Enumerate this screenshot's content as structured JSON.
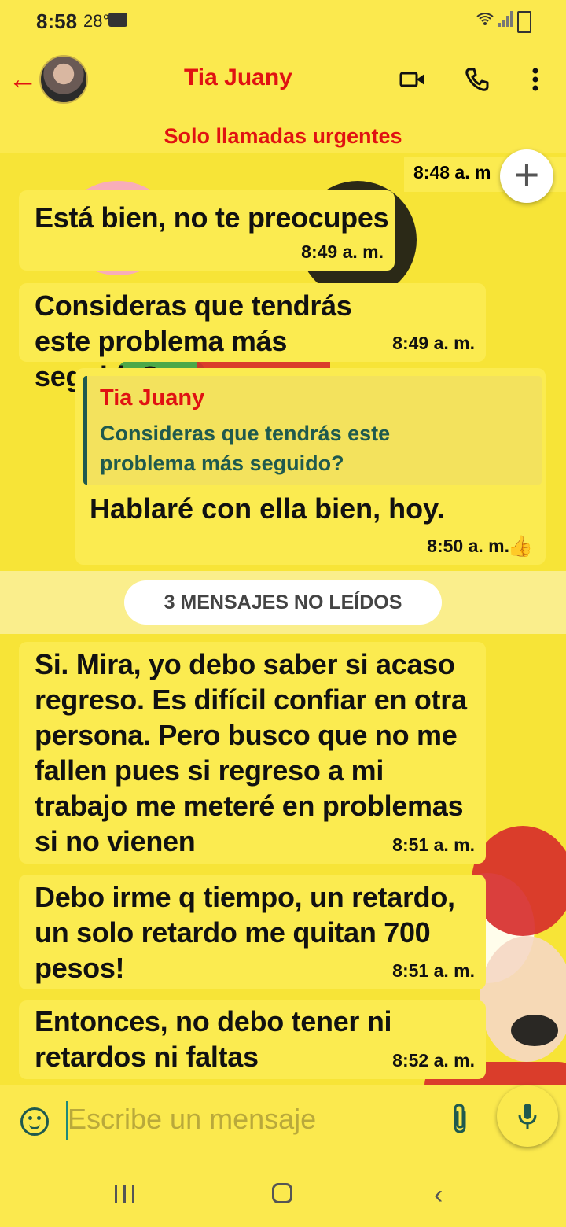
{
  "status_bar": {
    "time": "8:58",
    "temp": "28°"
  },
  "header": {
    "back_icon": "arrow-left-icon",
    "contact_name": "Tia Juany",
    "icons": [
      "video-camera-icon",
      "phone-icon",
      "more-vert-icon"
    ]
  },
  "banner": {
    "text": "Solo llamadas urgentes"
  },
  "messages": [
    {
      "time": "8:48 a. m"
    },
    {
      "text": "Está bien, no te preocupes",
      "time": "8:49 a. m."
    },
    {
      "text": "Consideras que tendrás este problema más seguido?",
      "time": "8:49 a. m."
    },
    {
      "quote_name": "Tia Juany",
      "quote_text": "Consideras que tendrás este problema más seguido?",
      "text": "Hablaré con ella bien, hoy.",
      "time": "8:50 a. m."
    },
    {
      "text": "Si. Mira, yo debo saber si acaso regreso. Es difícil confiar en otra persona. Pero busco que no me fallen pues si regreso a mi trabajo me meteré en problemas si no vienen",
      "time": "8:51 a. m."
    },
    {
      "text": "Debo irme q tiempo, un retardo, un solo retardo me quitan 700 pesos!",
      "time": "8:51 a. m."
    },
    {
      "text": "Entonces, no debo tener ni retardos ni faltas",
      "time": "8:52 a. m."
    }
  ],
  "unread": {
    "label": "3 MENSAJES NO LEÍDOS"
  },
  "input": {
    "placeholder": "Escribe un mensaje"
  },
  "colors": {
    "accent_red": "#e01212",
    "background_yellow": "#fbe94e",
    "teal": "#1f5a4e"
  }
}
